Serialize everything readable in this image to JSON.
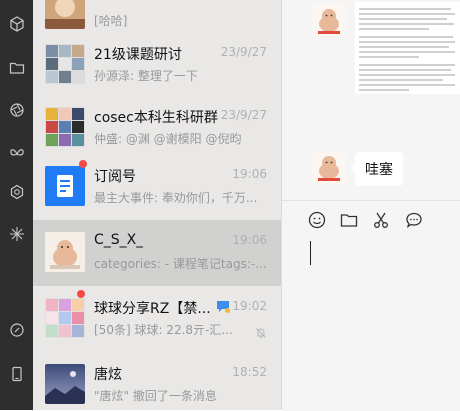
{
  "chat_list": [
    {
      "title": "",
      "preview": "[哈哈]",
      "time": ""
    },
    {
      "title": "21级课题研讨",
      "preview": "孙源泽: 整理了一下",
      "time": "23/9/27"
    },
    {
      "title": "cosec本科生科研群",
      "preview": "仲盛: @渊 @谢模阳 @倪昀",
      "time": "23/9/27"
    },
    {
      "title": "订阅号",
      "preview": "最主大事件: 奉劝你们，千万...",
      "time": "19:06"
    },
    {
      "title": "C_S_X_",
      "preview": "categories: - 课程笔记tags:-...",
      "time": "19:06"
    },
    {
      "title": "球球分享RZ【禁...",
      "preview": "[50条] 球球: 22.8亓-汇...",
      "time": "19:02"
    },
    {
      "title": "唐炫",
      "preview": "\"唐炫\" 撤回了一条消息",
      "time": "18:52"
    }
  ],
  "conversation": {
    "bubble_text": "哇塞"
  },
  "icons": {
    "rail": [
      "cube-icon",
      "folder-icon",
      "aperture-icon",
      "butterfly-icon",
      "hexagon-icon",
      "sparkle-icon",
      "link-icon",
      "phone-icon"
    ],
    "toolbar": [
      "emoji-icon",
      "folder-icon",
      "scissors-icon",
      "chat-bubble-icon"
    ]
  },
  "colors": {
    "unread_dot": "#f44949",
    "subscription_blue": "#1f7cf5",
    "rail_bg": "#2e2e2e",
    "list_bg": "#e9e8e7",
    "selected_bg": "#d1d1d0"
  }
}
